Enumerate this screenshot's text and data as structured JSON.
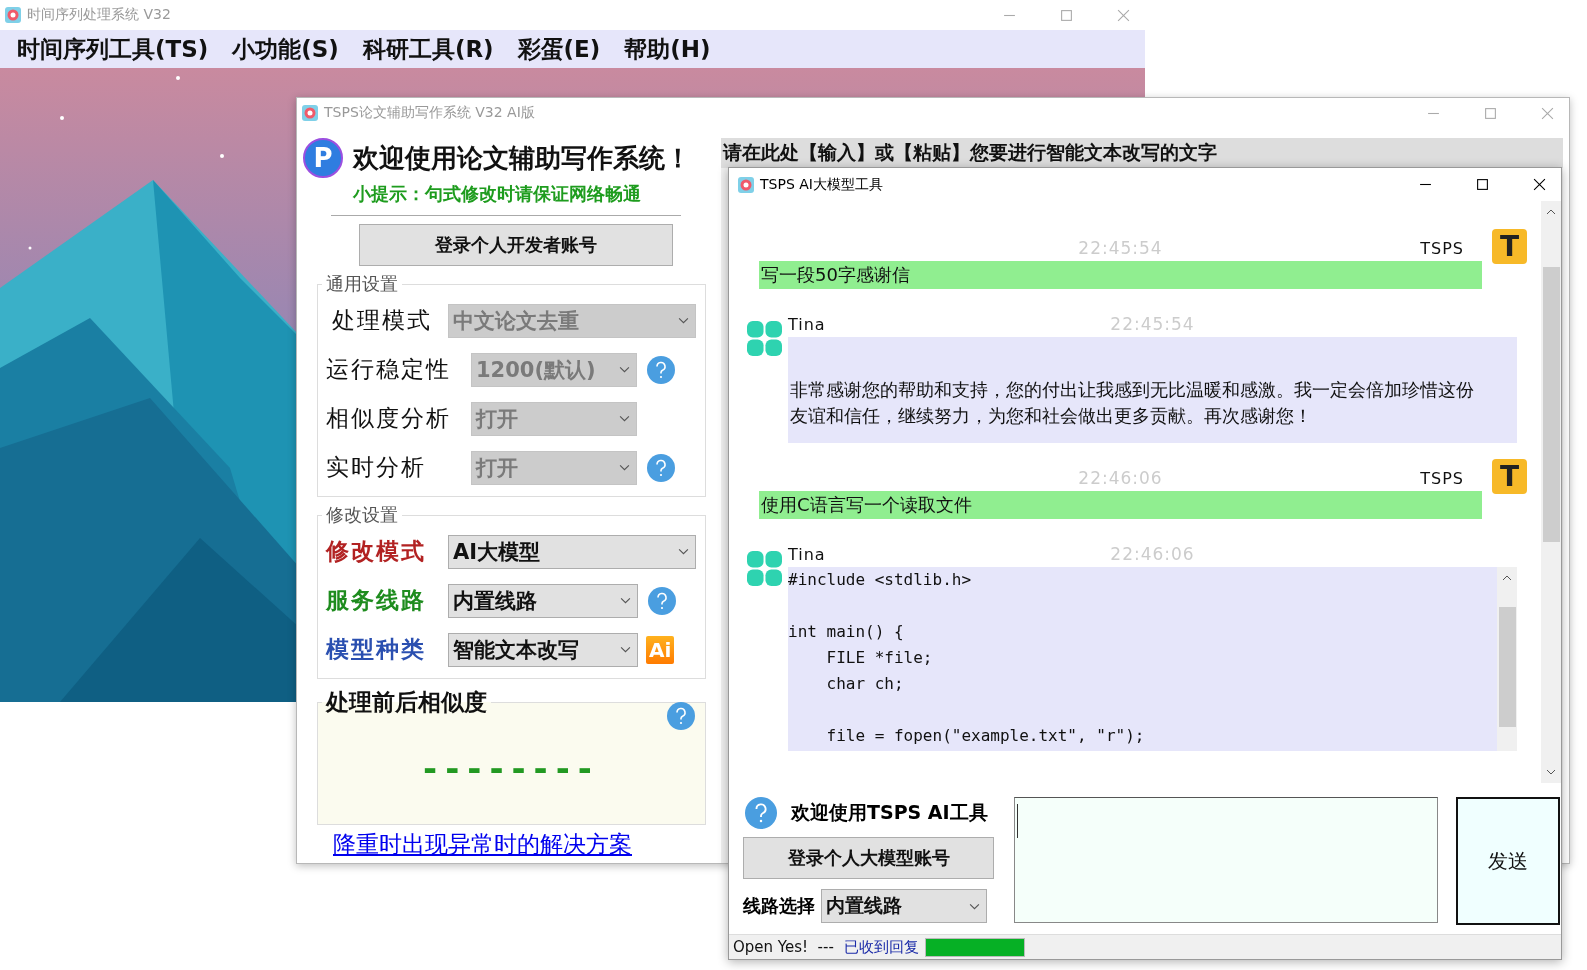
{
  "main_window": {
    "title": "时间序列处理系统 V32",
    "menu": [
      "时间序列工具(TS)",
      "小功能(S)",
      "科研工具(R)",
      "彩蛋(E)",
      "帮助(H)"
    ]
  },
  "writer_window": {
    "title": "TSPS论文辅助写作系统 V32 AI版",
    "logo": "P",
    "heading": "欢迎使用论文辅助写作系统！",
    "hint": "小提示：句式修改时请保证网络畅通",
    "login_button": "登录个人开发者账号",
    "general_settings": {
      "legend": "通用设置",
      "rows": [
        {
          "label": "处理模式",
          "value": "中文论文去重",
          "disabled": true,
          "help": false
        },
        {
          "label": "运行稳定性",
          "value": "1200(默认)",
          "disabled": true,
          "help": true
        },
        {
          "label": "相似度分析",
          "value": "打开",
          "disabled": true,
          "help": false
        },
        {
          "label": "实时分析",
          "value": "打开",
          "disabled": true,
          "help": true
        }
      ]
    },
    "modify_settings": {
      "legend": "修改设置",
      "rows": [
        {
          "label": "修改模式",
          "color": "#b22222",
          "value": "AI大模型",
          "disabled": false,
          "help": false
        },
        {
          "label": "服务线路",
          "color": "#1e8c1e",
          "value": "内置线路",
          "disabled": false,
          "help": true
        },
        {
          "label": "模型种类",
          "color": "#2a4fb0",
          "value": "智能文本改写",
          "disabled": false,
          "help": false,
          "badge": "Ai"
        }
      ]
    },
    "similarity": {
      "legend": "处理前后相似度",
      "reading": "--------"
    },
    "link": "降重时出现异常时的解决方案",
    "input_prompt": "请在此处【输入】或【粘贴】您要进行智能文本改写的文字"
  },
  "chat_window": {
    "title": "TSPS AI大模型工具",
    "messages": [
      {
        "kind": "user",
        "sender": "TSPS",
        "avatar": "T",
        "time": "22:45:54",
        "text": "写一段50字感谢信"
      },
      {
        "kind": "bot",
        "sender": "Tina",
        "time": "22:45:54",
        "text": "非常感谢您的帮助和支持，您的付出让我感到无比温暖和感激。我一定会倍加珍惜这份友谊和信任，继续努力，为您和社会做出更多贡献。再次感谢您！"
      },
      {
        "kind": "user",
        "sender": "TSPS",
        "avatar": "T",
        "time": "22:46:06",
        "text": "使用C语言写一个读取文件"
      },
      {
        "kind": "code",
        "sender": "Tina",
        "time": "22:46:06",
        "text": "#include <stdlib.h>\n\nint main() {\n    FILE *file;\n    char ch;\n\n    file = fopen(\"example.txt\", \"r\");"
      }
    ],
    "welcome": "欢迎使用TSPS AI工具",
    "login_button": "登录个人大模型账号",
    "route_label": "线路选择",
    "route_value": "内置线路",
    "send_button": "发送",
    "status": {
      "text": "Open Yes!  ---",
      "reply": "已收到回复",
      "level": 1
    }
  }
}
